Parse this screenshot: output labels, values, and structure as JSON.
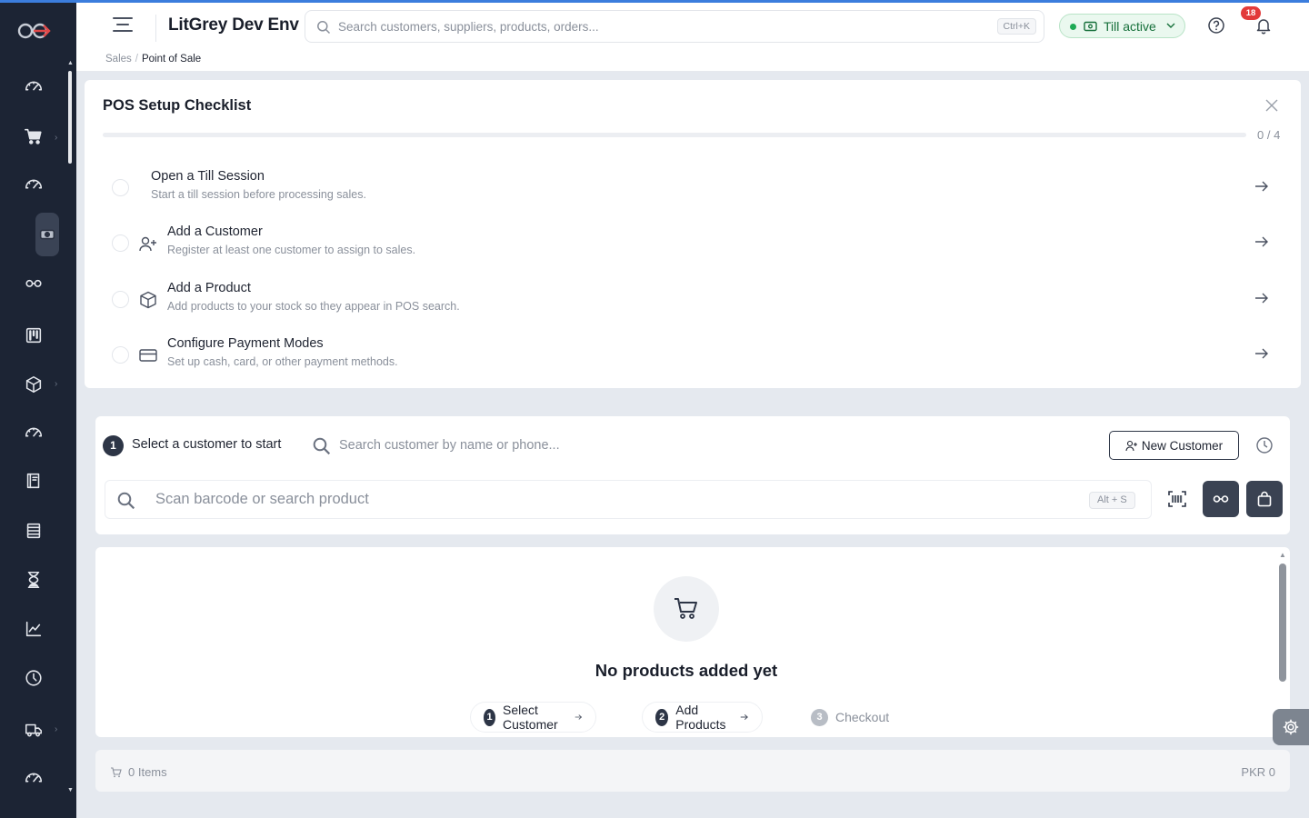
{
  "header": {
    "app_title": "LitGrey Dev Env",
    "search_placeholder": "Search customers, suppliers, products, orders...",
    "search_shortcut": "Ctrl+K",
    "till_status": "Till active",
    "notification_count": "18",
    "status_color": "#1eaa55"
  },
  "breadcrumb": {
    "parent": "Sales",
    "current": "Point of Sale"
  },
  "sidebar": {
    "items": [
      {
        "icon": "dashboard-gauge-icon"
      },
      {
        "icon": "shopping-cart-icon",
        "has_submenu": true
      },
      {
        "icon": "dashboard-gauge-icon"
      },
      {
        "icon": "cash-register-icon",
        "active": true
      },
      {
        "icon": "glasses-icon"
      },
      {
        "icon": "kanban-board-icon"
      },
      {
        "icon": "package-box-icon",
        "has_submenu": true
      },
      {
        "icon": "dashboard-gauge-icon"
      },
      {
        "icon": "ledger-book-icon"
      },
      {
        "icon": "list-rows-icon"
      },
      {
        "icon": "hourglass-icon"
      },
      {
        "icon": "line-chart-icon"
      },
      {
        "icon": "clock-icon"
      },
      {
        "icon": "delivery-truck-icon",
        "has_submenu": true
      },
      {
        "icon": "dashboard-gauge-icon"
      }
    ]
  },
  "checklist": {
    "title": "POS Setup Checklist",
    "progress_text": "0 / 4",
    "progress_fraction": 0,
    "items": [
      {
        "title": "Open a Till Session",
        "desc": "Start a till session before processing sales.",
        "icon": ""
      },
      {
        "title": "Add a Customer",
        "desc": "Register at least one customer to assign to sales.",
        "icon": "user-plus-icon"
      },
      {
        "title": "Add a Product",
        "desc": "Add products to your stock so they appear in POS search.",
        "icon": "package-box-icon"
      },
      {
        "title": "Configure Payment Modes",
        "desc": "Set up cash, card, or other payment methods.",
        "icon": "credit-card-icon"
      }
    ]
  },
  "pos": {
    "step_number": "1",
    "customer_label": "Select a customer to start",
    "customer_placeholder": "Search customer by name or phone...",
    "new_customer_label": "New Customer",
    "product_placeholder": "Scan barcode or search product",
    "product_shortcut": "Alt + S"
  },
  "cart": {
    "empty_title": "No products added yet",
    "steps": [
      {
        "n": "1",
        "label": "Select Customer"
      },
      {
        "n": "2",
        "label": "Add Products"
      },
      {
        "n": "3",
        "label": "Checkout"
      }
    ]
  },
  "footer": {
    "items_count": "0 Items",
    "total": "PKR 0"
  }
}
